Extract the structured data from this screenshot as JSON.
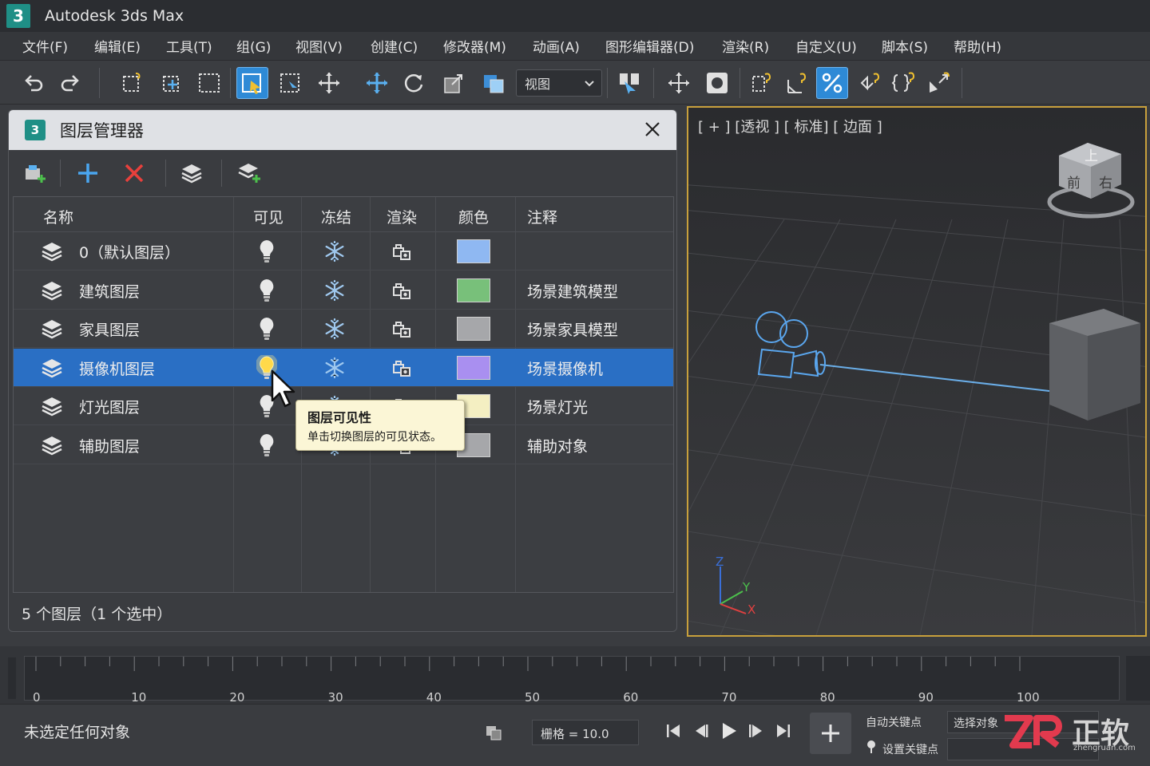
{
  "app": {
    "logo": "3",
    "title": "Autodesk 3ds Max"
  },
  "menu": [
    "文件(F)",
    "编辑(E)",
    "工具(T)",
    "组(G)",
    "视图(V)",
    "创建(C)",
    "修改器(M)",
    "动画(A)",
    "图形编辑器(D)",
    "渲染(R)",
    "自定义(U)",
    "脚本(S)",
    "帮助(H)"
  ],
  "toolbar": {
    "view_dropdown": "视图"
  },
  "layer_manager": {
    "logo": "3",
    "title": "图层管理器",
    "columns": [
      "名称",
      "可见",
      "冻结",
      "渲染",
      "颜色",
      "注释"
    ],
    "rows": [
      {
        "name": "0（默认图层）",
        "note": "",
        "color": "#8fb8f2",
        "selected": false
      },
      {
        "name": "建筑图层",
        "note": "场景建筑模型",
        "color": "#78c07a",
        "selected": false
      },
      {
        "name": "家具图层",
        "note": "场景家具模型",
        "color": "#a6a7aa",
        "selected": false
      },
      {
        "name": "摄像机图层",
        "note": "场景摄像机",
        "color": "#a98ff0",
        "selected": true
      },
      {
        "name": "灯光图层",
        "note": "场景灯光",
        "color": "#f4efc2",
        "selected": false
      },
      {
        "name": "辅助图层",
        "note": "辅助对象",
        "color": "#a6a7aa",
        "selected": false
      }
    ],
    "footer": "5 个图层（1 个选中）",
    "tooltip": {
      "title": "图层可见性",
      "desc": "单击切换图层的可见状态。"
    }
  },
  "viewport": {
    "label": "[ + ] [透视 ] [ 标准] [ 边面 ]",
    "viewcube": {
      "top": "上",
      "front": "前",
      "right": "右"
    },
    "axes": {
      "z": "Z",
      "y": "Y",
      "x": "X"
    }
  },
  "timeline": {
    "ticks": [
      "0",
      "10",
      "20",
      "30",
      "40",
      "50",
      "60",
      "70",
      "80",
      "90",
      "100"
    ]
  },
  "status": {
    "text": "未选定任何对象",
    "grid": "栅格 = 10.0",
    "auto_key": "自动关键点",
    "set_key": "设置关键点",
    "select_object": "选择对象"
  },
  "watermark": {
    "brand": "正软",
    "site": "zhengruan.com"
  },
  "colors": {
    "accent": "#2a6fc4",
    "viewport_border": "#c8a03c",
    "logo_teal": "#1f8f86"
  }
}
